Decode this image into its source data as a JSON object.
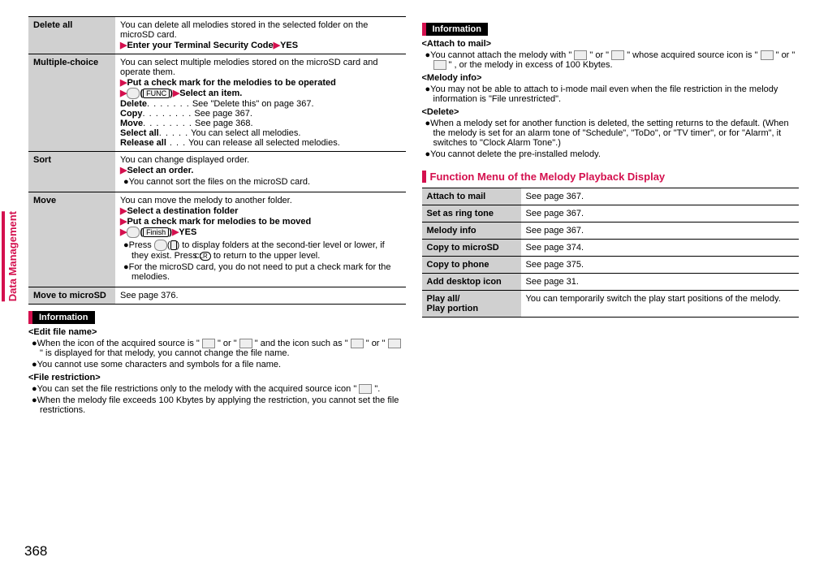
{
  "sidetab": "Data Management",
  "pageNum": "368",
  "leftTable": {
    "deleteAll": {
      "hd": "Delete all",
      "line1": "You can delete all melodies stored in the selected folder on the microSD card.",
      "line2a": "Enter your Terminal Security Code",
      "line2b": "YES"
    },
    "multi": {
      "hd": "Multiple-choice",
      "line1": "You can select multiple melodies stored on the microSD card and operate them.",
      "step1": "Put a check mark for the melodies to be operated",
      "step2a": "Select an item.",
      "rows": [
        {
          "k": "Delete",
          "d": ". . . . . . .",
          "v": "See \"Delete this\" on page 367."
        },
        {
          "k": "Copy",
          "d": ". . . . . . . .",
          "v": "See page 367."
        },
        {
          "k": "Move",
          "d": ". . . . . . . .",
          "v": "See page 368."
        },
        {
          "k": "Select all",
          "d": ". . . . .",
          "v": "You can select all melodies."
        },
        {
          "k": "Release all",
          "d": " . . .",
          "v": "You can release all selected melodies."
        }
      ],
      "funcLabel": "FUNC",
      "irIcon": "ir-icon"
    },
    "sort": {
      "hd": "Sort",
      "line1": "You can change displayed order.",
      "step": "Select an order.",
      "note": "You cannot sort the files on the microSD card."
    },
    "move": {
      "hd": "Move",
      "line1": "You can move the melody to another folder.",
      "step1": "Select a destination folder",
      "step2": "Put a check mark for melodies to be moved",
      "step3yes": "YES",
      "finishLabel": "Finish",
      "note1": "Press ",
      "note1b": " to display folders at the second-tier level or lower, if they exist. Press ",
      "note1c": " to return to the upper level.",
      "clr": "CLR",
      "note2": "For the microSD card, you do not need to put a check mark for the melodies."
    },
    "moveSD": {
      "hd": "Move to microSD",
      "v": "See page 376."
    }
  },
  "leftInfo": {
    "title": "Information",
    "editFileName": "<Edit file name>",
    "ef1a": "When the icon of the acquired source is \" ",
    "ef1b": " \" or \" ",
    "ef1c": " \" and the icon such as \" ",
    "ef1d": " \" or \" ",
    "ef1e": " \" is displayed for that melody, you cannot change the file name.",
    "ef2": "You cannot use some characters and symbols for a file name.",
    "fileRest": "<File restriction>",
    "fr1a": "You can set the file restrictions only to the melody with the acquired source icon \" ",
    "fr1b": " \".",
    "fr2": "When the melody file exceeds 100 Kbytes by applying the restriction, you cannot set the file restrictions."
  },
  "rightInfo": {
    "title": "Information",
    "attach": "<Attach to mail>",
    "at1a": "You cannot attach the melody with \" ",
    "at1b": " \" or \" ",
    "at1c": " \"  whose acquired source icon is \" ",
    "at1d": " \" or \" ",
    "at1e": " \" , or the melody in excess of 100 Kbytes.",
    "melInfo": "<Melody info>",
    "mi1": "You may not be able to attach to i-mode mail even when the file restriction in the melody information is \"File unrestricted\".",
    "del": "<Delete>",
    "d1": "When a melody set for another function is deleted, the setting returns to the default. (When the melody is set for an alarm tone of \"Schedule\", \"ToDo\", or \"TV timer\", or for \"Alarm\", it switches to \"Clock Alarm Tone\".)",
    "d2": "You cannot delete the pre-installed melody."
  },
  "funcMenuTitle": "Function Menu of the Melody Playback Display",
  "rightTable": [
    {
      "k": "Attach to mail",
      "v": "See page 367."
    },
    {
      "k": "Set as ring tone",
      "v": "See page 367."
    },
    {
      "k": "Melody info",
      "v": "See page 367."
    },
    {
      "k": "Copy to microSD",
      "v": "See page 374."
    },
    {
      "k": "Copy to phone",
      "v": "See page 375."
    },
    {
      "k": "Add desktop icon",
      "v": "See page 31."
    },
    {
      "k": "Play all/\nPlay portion",
      "v": "You can temporarily switch the play start positions of the melody."
    }
  ]
}
